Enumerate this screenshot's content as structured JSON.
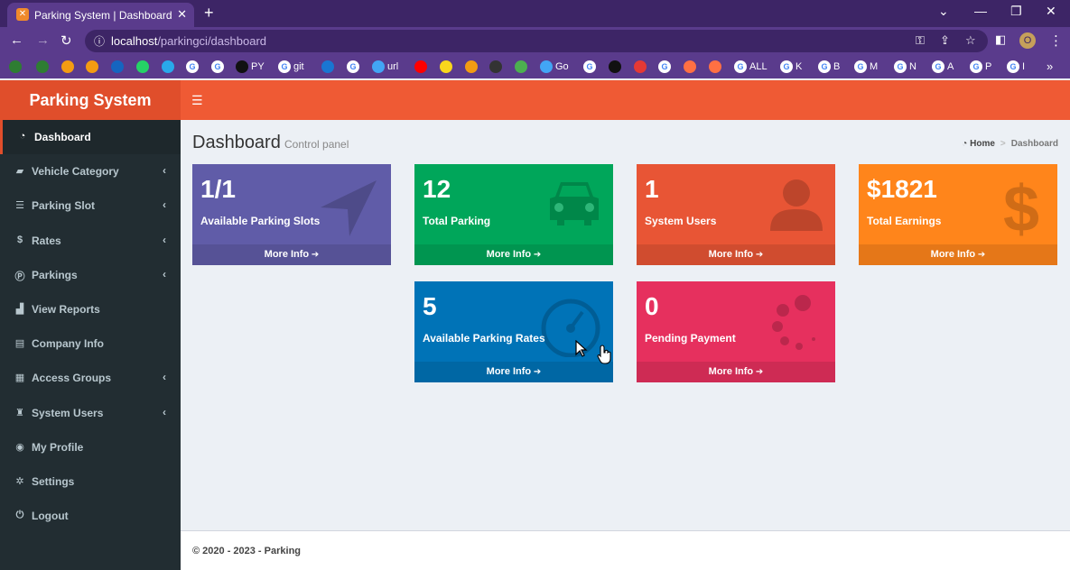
{
  "browser": {
    "tab_title": "Parking System | Dashboard",
    "url_host": "localhost",
    "url_path": "/parkingci/dashboard",
    "profile_initial": "O",
    "bookmarks": [
      {
        "label": "",
        "icon": "green-icon",
        "color": "#2e7d32"
      },
      {
        "label": "",
        "icon": "plus-icon",
        "color": "#2e7d32"
      },
      {
        "label": "",
        "icon": "orange-icon",
        "color": "#f39c12"
      },
      {
        "label": "",
        "icon": "chart-icon",
        "color": "#f39c12"
      },
      {
        "label": "",
        "icon": "ieee-icon",
        "color": "#1565c0"
      },
      {
        "label": "",
        "icon": "whatsapp-icon",
        "color": "#25d366"
      },
      {
        "label": "",
        "icon": "telegram-icon",
        "color": "#29a9eb"
      },
      {
        "label": "",
        "icon": "google-icon",
        "color": "#ffffff"
      },
      {
        "label": "",
        "icon": "google-icon",
        "color": "#ffffff"
      },
      {
        "label": "PY",
        "icon": "github-icon",
        "color": "#111111"
      },
      {
        "label": "git",
        "icon": "google-icon",
        "color": "#ffffff"
      },
      {
        "label": "",
        "icon": "image-icon",
        "color": "#1976d2"
      },
      {
        "label": "",
        "icon": "store-icon",
        "color": "#ffffff"
      },
      {
        "label": "url",
        "icon": "cloud-icon",
        "color": "#42a5f5"
      },
      {
        "label": "",
        "icon": "youtube-icon",
        "color": "#ff0000"
      },
      {
        "label": "",
        "icon": "p-icon",
        "color": "#f9d71c"
      },
      {
        "label": "",
        "icon": "camera-icon",
        "color": "#f39c12"
      },
      {
        "label": "",
        "icon": "lion-icon",
        "color": "#333333"
      },
      {
        "label": "",
        "icon": "ring-icon",
        "color": "#4caf50"
      },
      {
        "label": "Go",
        "icon": "globe-icon",
        "color": "#42a5f5"
      },
      {
        "label": "",
        "icon": "flag-icon",
        "color": "#ffffff"
      },
      {
        "label": "",
        "icon": "cl-icon",
        "color": "#111111"
      },
      {
        "label": "",
        "icon": "ya-icon",
        "color": "#e53935"
      },
      {
        "label": "",
        "icon": "google-icon",
        "color": "#ffffff"
      },
      {
        "label": "",
        "icon": "bolt-icon",
        "color": "#ff7043"
      },
      {
        "label": "",
        "icon": "ad-icon",
        "color": "#ff7043"
      },
      {
        "label": "ALL",
        "icon": "globe-icon",
        "color": "#ffffff"
      },
      {
        "label": "K",
        "icon": "google-icon",
        "color": "#ffffff"
      },
      {
        "label": "B",
        "icon": "google-icon",
        "color": "#ffffff"
      },
      {
        "label": "M",
        "icon": "google-icon",
        "color": "#ffffff"
      },
      {
        "label": "N",
        "icon": "google-icon",
        "color": "#ffffff"
      },
      {
        "label": "A",
        "icon": "google-icon",
        "color": "#ffffff"
      },
      {
        "label": "P",
        "icon": "google-icon",
        "color": "#ffffff"
      },
      {
        "label": "I",
        "icon": "google-icon",
        "color": "#ffffff"
      }
    ]
  },
  "app": {
    "logo": "Parking System",
    "page_title": "Dashboard",
    "page_subtitle": "Control panel",
    "breadcrumb_home": "Home",
    "breadcrumb_current": "Dashboard",
    "footer": "© 2020 - 2023 - Parking"
  },
  "sidebar": [
    {
      "label": "Dashboard",
      "icon": "dashboard-icon",
      "glyph": "◔",
      "chevron": false,
      "active": true
    },
    {
      "label": "Vehicle Category",
      "icon": "car-icon",
      "glyph": "▰",
      "chevron": true,
      "active": false
    },
    {
      "label": "Parking Slot",
      "icon": "list-icon",
      "glyph": "☰",
      "chevron": true,
      "active": false
    },
    {
      "label": "Rates",
      "icon": "dollar-icon",
      "glyph": "$",
      "chevron": true,
      "active": false
    },
    {
      "label": "Parkings",
      "icon": "parking-icon",
      "glyph": "Ⓟ",
      "chevron": true,
      "active": false
    },
    {
      "label": "View Reports",
      "icon": "bar-chart-icon",
      "glyph": "▟",
      "chevron": false,
      "active": false
    },
    {
      "label": "Company Info",
      "icon": "building-icon",
      "glyph": "▤",
      "chevron": false,
      "active": false
    },
    {
      "label": "Access Groups",
      "icon": "grid-icon",
      "glyph": "▦",
      "chevron": true,
      "active": false
    },
    {
      "label": "System Users",
      "icon": "users-icon",
      "glyph": "♜",
      "chevron": true,
      "active": false
    },
    {
      "label": "My Profile",
      "icon": "user-circle-icon",
      "glyph": "◉",
      "chevron": false,
      "active": false
    },
    {
      "label": "Settings",
      "icon": "gears-icon",
      "glyph": "✲",
      "chevron": false,
      "active": false
    },
    {
      "label": "Logout",
      "icon": "power-icon",
      "glyph": "⏻",
      "chevron": false,
      "active": false
    }
  ],
  "boxes": [
    {
      "value": "1/1",
      "label": "Available Parking Slots",
      "more": "More Info",
      "color": "#605ca8",
      "icon": "location-arrow-icon"
    },
    {
      "value": "12",
      "label": "Total Parking",
      "more": "More Info",
      "color": "#00a65a",
      "icon": "car-icon"
    },
    {
      "value": "1",
      "label": "System Users",
      "more": "More Info",
      "color": "#e85535",
      "icon": "user-icon"
    },
    {
      "value": "$1821",
      "label": "Total Earnings",
      "more": "More Info",
      "color": "#ff851b",
      "icon": "dollar-icon"
    },
    {
      "value": "5",
      "label": "Available Parking Rates",
      "more": "More Info",
      "color": "#0073b7",
      "icon": "dashboard-gauge-icon"
    },
    {
      "value": "0",
      "label": "Pending Payment",
      "more": "More Info",
      "color": "#e6305e",
      "icon": "spinner-icon"
    }
  ]
}
